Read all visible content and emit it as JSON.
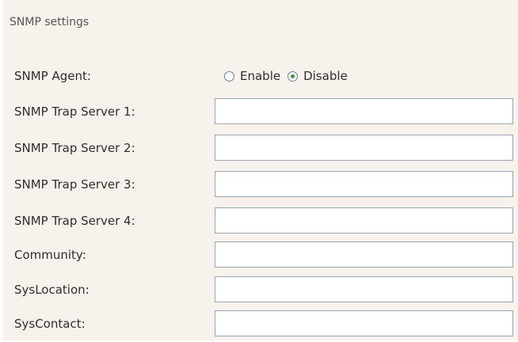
{
  "section_title": "SNMP settings",
  "agent": {
    "label": "SNMP Agent:",
    "options": [
      "Enable",
      "Disable"
    ],
    "selected": "Disable"
  },
  "fields": [
    {
      "label": "SNMP Trap Server 1:",
      "value": ""
    },
    {
      "label": "SNMP Trap Server 2:",
      "value": ""
    },
    {
      "label": "SNMP Trap Server 3:",
      "value": ""
    },
    {
      "label": "SNMP Trap Server 4:",
      "value": ""
    },
    {
      "label": "Community:",
      "value": ""
    },
    {
      "label": "SysLocation:",
      "value": ""
    },
    {
      "label": "SysContact:",
      "value": ""
    }
  ],
  "colors": {
    "panel_background": "#f8f2ec",
    "field_border": "#9aa4b2",
    "radio_selected": "#3a9a3a"
  }
}
